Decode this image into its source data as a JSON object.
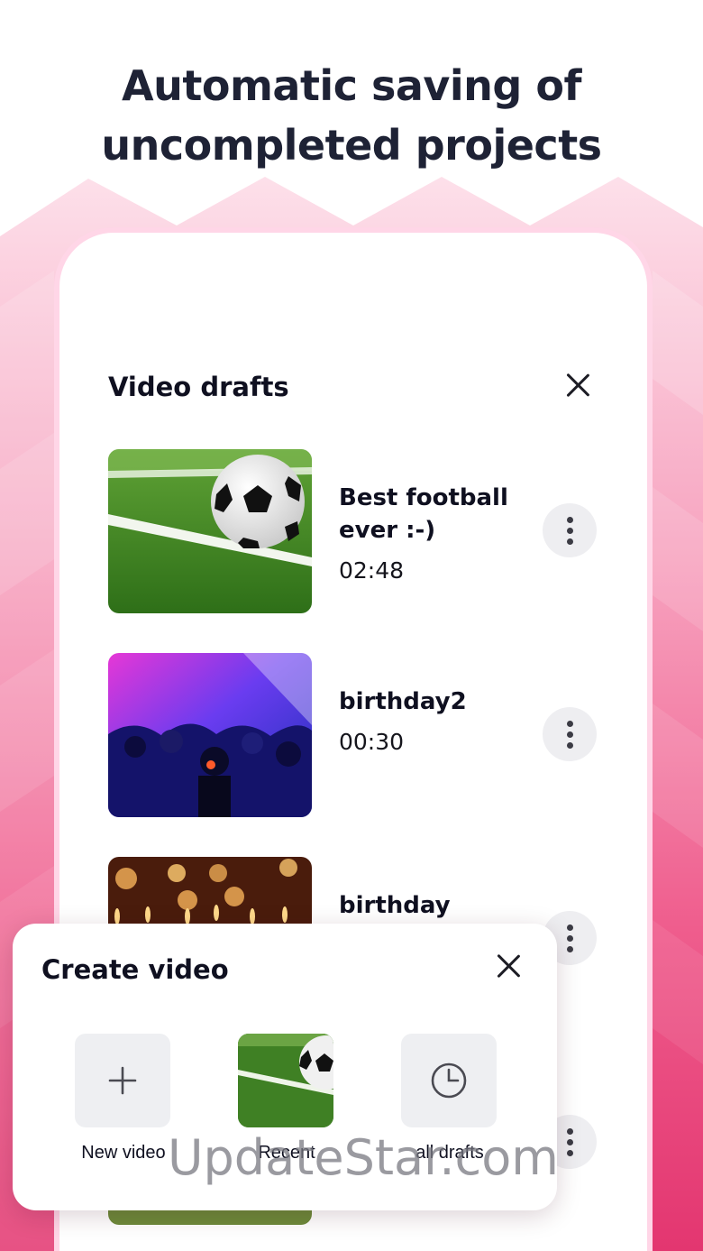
{
  "headline": {
    "line1": "Automatic saving of",
    "line2": "uncompleted projects"
  },
  "drafts_sheet": {
    "title": "Video drafts",
    "close_icon": "close-icon",
    "items": [
      {
        "name": "Best football ever :-)",
        "duration": "02:48",
        "thumbnail": "soccer-ball-on-grass",
        "menu_icon": "more-vertical-icon"
      },
      {
        "name": "birthday2",
        "duration": "00:30",
        "thumbnail": "party-crowd-neon",
        "menu_icon": "more-vertical-icon"
      },
      {
        "name": "birthday",
        "duration": "",
        "thumbnail": "birthday-candles",
        "menu_icon": "more-vertical-icon"
      },
      {
        "name": "",
        "duration": "",
        "thumbnail": "outdoor-grass",
        "menu_icon": "more-vertical-icon"
      }
    ]
  },
  "create_panel": {
    "title": "Create video",
    "close_icon": "close-icon",
    "options": [
      {
        "label": "New video",
        "icon": "plus-icon"
      },
      {
        "label": "Recent",
        "icon": "recent-thumbnail"
      },
      {
        "label": "all drafts",
        "icon": "clock-icon"
      }
    ]
  },
  "watermark": "UpdateStar.com",
  "colors": {
    "accent_pink": "#e8336f",
    "background_light_pink": "#fbd3e0",
    "title_text": "#1e2235",
    "tile_gray": "#eeeff2"
  }
}
